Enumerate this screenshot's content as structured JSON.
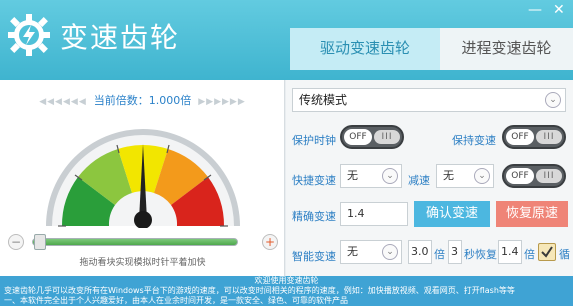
{
  "app": {
    "title": "变速齿轮",
    "minimize": "—",
    "close": "✕"
  },
  "tabs": [
    {
      "label": "驱动变速齿轮"
    },
    {
      "label": "进程变速齿轮"
    }
  ],
  "gauge": {
    "rate_label": "当前倍数：1.000倍",
    "arrows_left": "◀◀◀◀◀◀",
    "arrows_right": "▶▶▶▶▶▶",
    "speed_value": 1.0,
    "hint": "拖动看块实现模拟时针平着加快",
    "minus": "−",
    "plus": "+"
  },
  "mode": {
    "selected": "传统模式"
  },
  "controls": {
    "protect_clock": "保护时钟",
    "keep_speed": "保持变速",
    "toggle_off": "OFF",
    "toggle_grip": "III",
    "hotkey_speed": "快捷变速",
    "hotkey_speed_value": "无",
    "slow_down": "减速",
    "slow_down_value": "无",
    "precise_speed": "精确变速",
    "precise_value": "1.4",
    "confirm": "确认变速",
    "restore": "恢复原速",
    "smart_speed": "智能变速",
    "smart_value": "无",
    "factor": "3.0",
    "times": "倍",
    "seconds": "3",
    "sec_restore": "秒恢复",
    "factor2": "1.4",
    "times2": "倍",
    "cycle": "循"
  },
  "footer": {
    "line1": "欢迎使用变速齿轮",
    "line2": "变速齿轮几乎可以改变所有在Windows平台下的游戏的速度，可以改变时间相关的程序的速度，例如：加快播放视频、观看网页、打开flash等等",
    "line3": "一、本软件完全出于个人兴趣爱好，由本人在业余时间开发，是一款安全、绿色、可靠的软件产品"
  },
  "colors": {
    "accent": "#3fb4cf",
    "footer": "#3fa3d4",
    "confirm": "#4cb7e0",
    "restore": "#ef8477"
  }
}
